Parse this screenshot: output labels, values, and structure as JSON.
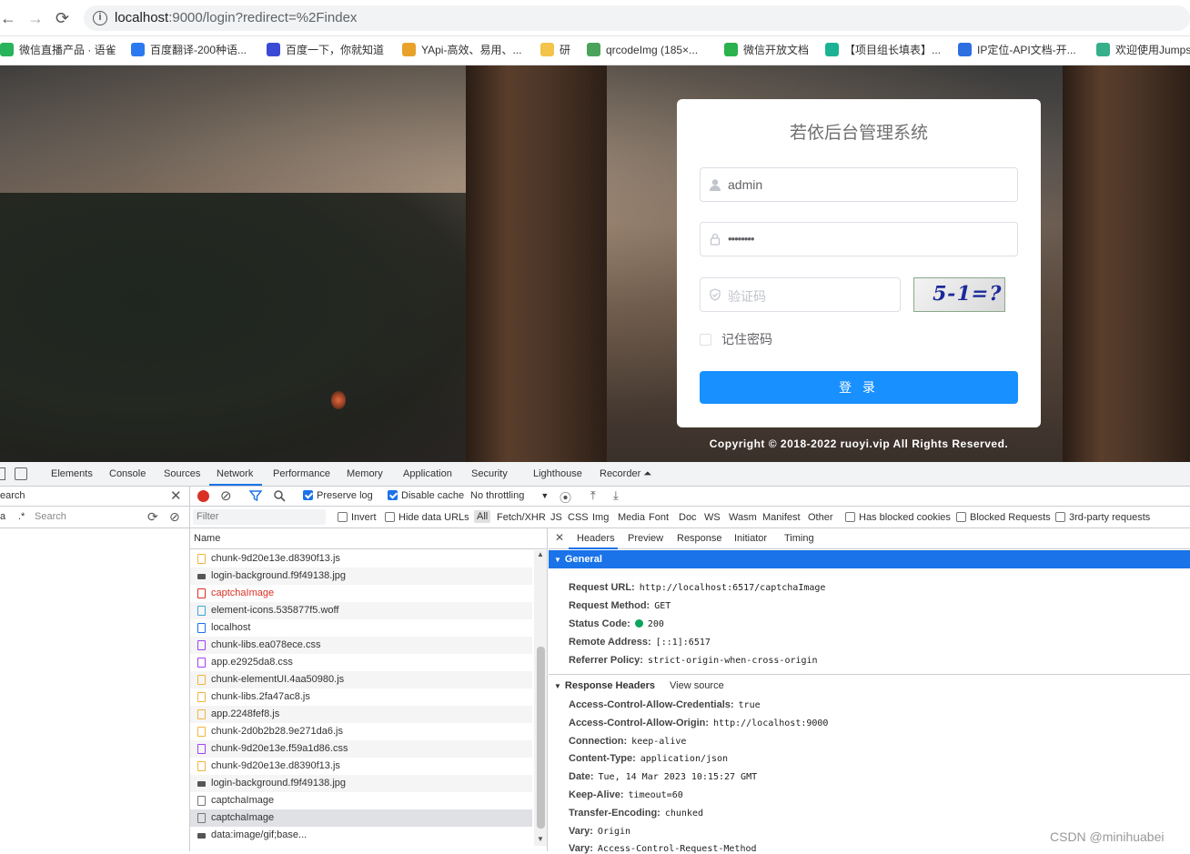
{
  "browser": {
    "back": "←",
    "forward": "→",
    "reload": "⟳",
    "info": "i",
    "url_host": "localhost",
    "url_rest": ":9000/login?redirect=%2Findex"
  },
  "bookmarks": [
    {
      "label": "微信直播产品 · 语雀",
      "color": "#29b35a"
    },
    {
      "label": "百度翻译-200种语...",
      "color": "#2b79f0"
    },
    {
      "label": "百度一下，你就知道",
      "color": "#3a4ad4"
    },
    {
      "label": "YApi-高效、易用、...",
      "color": "#e8a22a"
    },
    {
      "label": "研",
      "color": "#f3c34a"
    },
    {
      "label": "qrcodeImg (185×...",
      "color": "#4aa35a"
    },
    {
      "label": "微信开放文档",
      "color": "#2bb24c"
    },
    {
      "label": "【项目组长填表】...",
      "color": "#1bb394"
    },
    {
      "label": "IP定位-API文档-开...",
      "color": "#2d6ee0"
    },
    {
      "label": "欢迎使用Jumps",
      "color": "#35b08a"
    }
  ],
  "login": {
    "title": "若依后台管理系统",
    "username": "admin",
    "password": "••••••••",
    "captcha_placeholder": "验证码",
    "captcha_text": "5-1=?",
    "remember": "记住密码",
    "login_button": "登 录",
    "copyright": "Copyright © 2018-2022 ruoyi.vip All Rights Reserved."
  },
  "devtools": {
    "tabs": [
      "Elements",
      "Console",
      "Sources",
      "Network",
      "Performance",
      "Memory",
      "Application",
      "Security",
      "Lighthouse",
      "Recorder ⏶"
    ],
    "active_tab": "Network",
    "search_label": "earch",
    "search_placeholder": "Search",
    "search_aa": "a",
    "search_regex": ".*",
    "toolbar": {
      "preserve_log": "Preserve log",
      "disable_cache": "Disable cache",
      "throttling": "No throttling"
    },
    "filter": {
      "placeholder": "Filter",
      "invert": "Invert",
      "hide_data_urls": "Hide data URLs",
      "types": [
        "All",
        "Fetch/XHR",
        "JS",
        "CSS",
        "Img",
        "Media",
        "Font",
        "Doc",
        "WS",
        "Wasm",
        "Manifest",
        "Other"
      ],
      "has_blocked_cookies": "Has blocked cookies",
      "blocked_requests": "Blocked Requests",
      "third_party": "3rd-party requests"
    },
    "name_header": "Name",
    "requests": [
      {
        "name": "chunk-9d20e13e.d8390f13.js",
        "kind": "js"
      },
      {
        "name": "login-background.f9f49138.jpg",
        "kind": "img"
      },
      {
        "name": "captchaImage",
        "kind": "red"
      },
      {
        "name": "element-icons.535877f5.woff",
        "kind": "font"
      },
      {
        "name": "localhost",
        "kind": "doc"
      },
      {
        "name": "chunk-libs.ea078ece.css",
        "kind": "css"
      },
      {
        "name": "app.e2925da8.css",
        "kind": "css"
      },
      {
        "name": "chunk-elementUI.4aa50980.js",
        "kind": "js"
      },
      {
        "name": "chunk-libs.2fa47ac8.js",
        "kind": "js"
      },
      {
        "name": "app.2248fef8.js",
        "kind": "js"
      },
      {
        "name": "chunk-2d0b2b28.9e271da6.js",
        "kind": "js"
      },
      {
        "name": "chunk-9d20e13e.f59a1d86.css",
        "kind": "css"
      },
      {
        "name": "chunk-9d20e13e.d8390f13.js",
        "kind": "js"
      },
      {
        "name": "login-background.f9f49138.jpg",
        "kind": "img"
      },
      {
        "name": "captchaImage",
        "kind": "xhr"
      },
      {
        "name": "captchaImage",
        "kind": "xhr-sel"
      },
      {
        "name": "data:image/gif;base...",
        "kind": "img"
      }
    ],
    "detail_tabs": [
      "Headers",
      "Preview",
      "Response",
      "Initiator",
      "Timing"
    ],
    "general_label": "General",
    "general": [
      {
        "k": "Request URL:",
        "v": "http://localhost:6517/captchaImage"
      },
      {
        "k": "Request Method:",
        "v": "GET"
      },
      {
        "k": "Status Code:",
        "v": "200"
      },
      {
        "k": "Remote Address:",
        "v": "[::1]:6517"
      },
      {
        "k": "Referrer Policy:",
        "v": "strict-origin-when-cross-origin"
      }
    ],
    "response_headers_label": "Response Headers",
    "view_source": "View source",
    "response_headers": [
      {
        "k": "Access-Control-Allow-Credentials:",
        "v": "true"
      },
      {
        "k": "Access-Control-Allow-Origin:",
        "v": "http://localhost:9000"
      },
      {
        "k": "Connection:",
        "v": "keep-alive"
      },
      {
        "k": "Content-Type:",
        "v": "application/json"
      },
      {
        "k": "Date:",
        "v": "Tue, 14 Mar 2023 10:15:27 GMT"
      },
      {
        "k": "Keep-Alive:",
        "v": "timeout=60"
      },
      {
        "k": "Transfer-Encoding:",
        "v": "chunked"
      },
      {
        "k": "Vary:",
        "v": "Origin"
      },
      {
        "k": "Vary:",
        "v": "Access-Control-Request-Method"
      }
    ]
  },
  "watermark": "CSDN @minihuabei",
  "colors": {
    "accent": "#1890ff",
    "devtools_accent": "#1a73e8",
    "status_ok": "#0ca45e",
    "error": "#d93025"
  }
}
